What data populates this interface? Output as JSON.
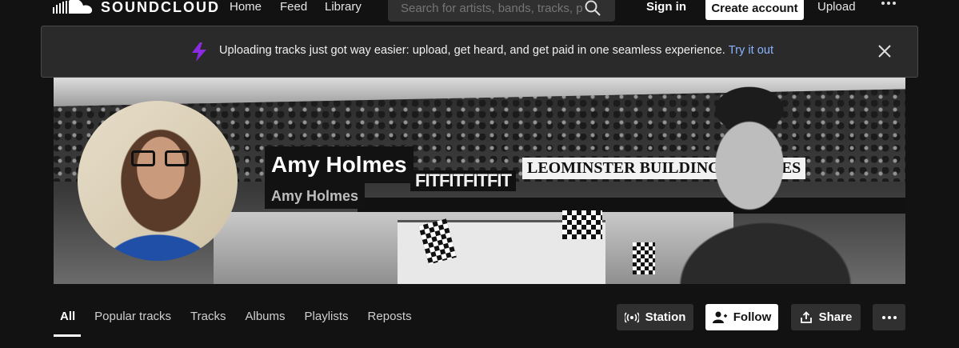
{
  "nav": {
    "logo_text": "SOUNDCLOUD",
    "home": "Home",
    "feed": "Feed",
    "library": "Library",
    "search_placeholder": "Search for artists, bands, tracks, podcasts",
    "sign_in": "Sign in",
    "create_account": "Create account",
    "upload": "Upload"
  },
  "banner": {
    "message": "Uploading tracks just got way easier: upload, get heard, and get paid in one seamless experience.",
    "link": "Try it out",
    "accent_color": "#8a2be2"
  },
  "profile": {
    "display_name": "Amy Holmes",
    "username": "Amy Holmes",
    "header_image_text_1": "LEOMINSTER BUILDING SUPPLIES",
    "header_image_text_2": "FITFITFITFIT"
  },
  "tabs": [
    {
      "label": "All",
      "active": true
    },
    {
      "label": "Popular tracks",
      "active": false
    },
    {
      "label": "Tracks",
      "active": false
    },
    {
      "label": "Albums",
      "active": false
    },
    {
      "label": "Playlists",
      "active": false
    },
    {
      "label": "Reposts",
      "active": false
    }
  ],
  "actions": {
    "station": "Station",
    "follow": "Follow",
    "share": "Share"
  },
  "icons": [
    "soundcloud-logo-icon",
    "search-icon",
    "more-icon",
    "bolt-icon",
    "close-icon",
    "station-icon",
    "follow-icon",
    "share-icon"
  ]
}
